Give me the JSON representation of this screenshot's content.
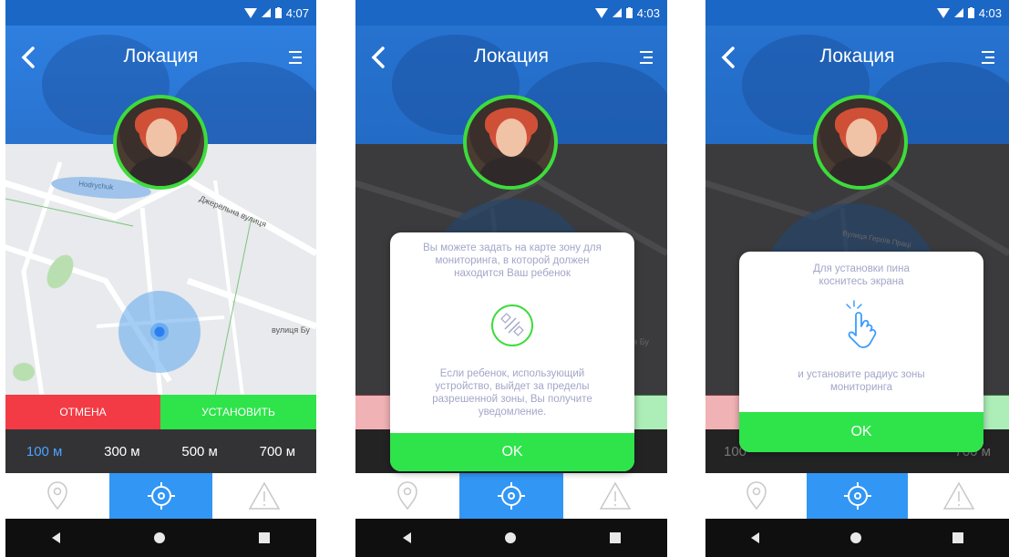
{
  "status_time": [
    "4:07",
    "4:03",
    "4:03"
  ],
  "header": {
    "title": "Локация"
  },
  "screen1": {
    "map_labels": {
      "lake": "Hodrychuk",
      "street1": "Джерельна вулиця",
      "street2": "вулиця Бу"
    },
    "cancel_label": "ОТМЕНА",
    "set_label": "УСТАНОВИТЬ",
    "radius_options": [
      "100 м",
      "300 м",
      "500 м",
      "700 м"
    ],
    "radius_selected": "100 м"
  },
  "screen2": {
    "dialog_text_top": "Вы можете задать на карте зону для мониторинга, в которой должен находится Ваш ребенок",
    "dialog_text_bottom": "Если ребенок, использующий устройство, выйдет за пределы разрешенной зоны, Вы получите уведомление.",
    "ok_label": "OK",
    "bg_street": "вулиця Бу"
  },
  "screen3": {
    "dialog_text_top": "Для установки пина коснитесь экрана",
    "dialog_text_bottom": "и установите радиус зоны мониторинга",
    "ok_label": "OK",
    "bg_street": "Вулиця Героїв Праці",
    "bg_radius_left": "100",
    "bg_radius_right": "700 м"
  },
  "colors": {
    "header_blue": "#2c79d8",
    "accent_green": "#2ee44a",
    "cancel_red": "#f23b44",
    "active_tab": "#3296f4"
  }
}
